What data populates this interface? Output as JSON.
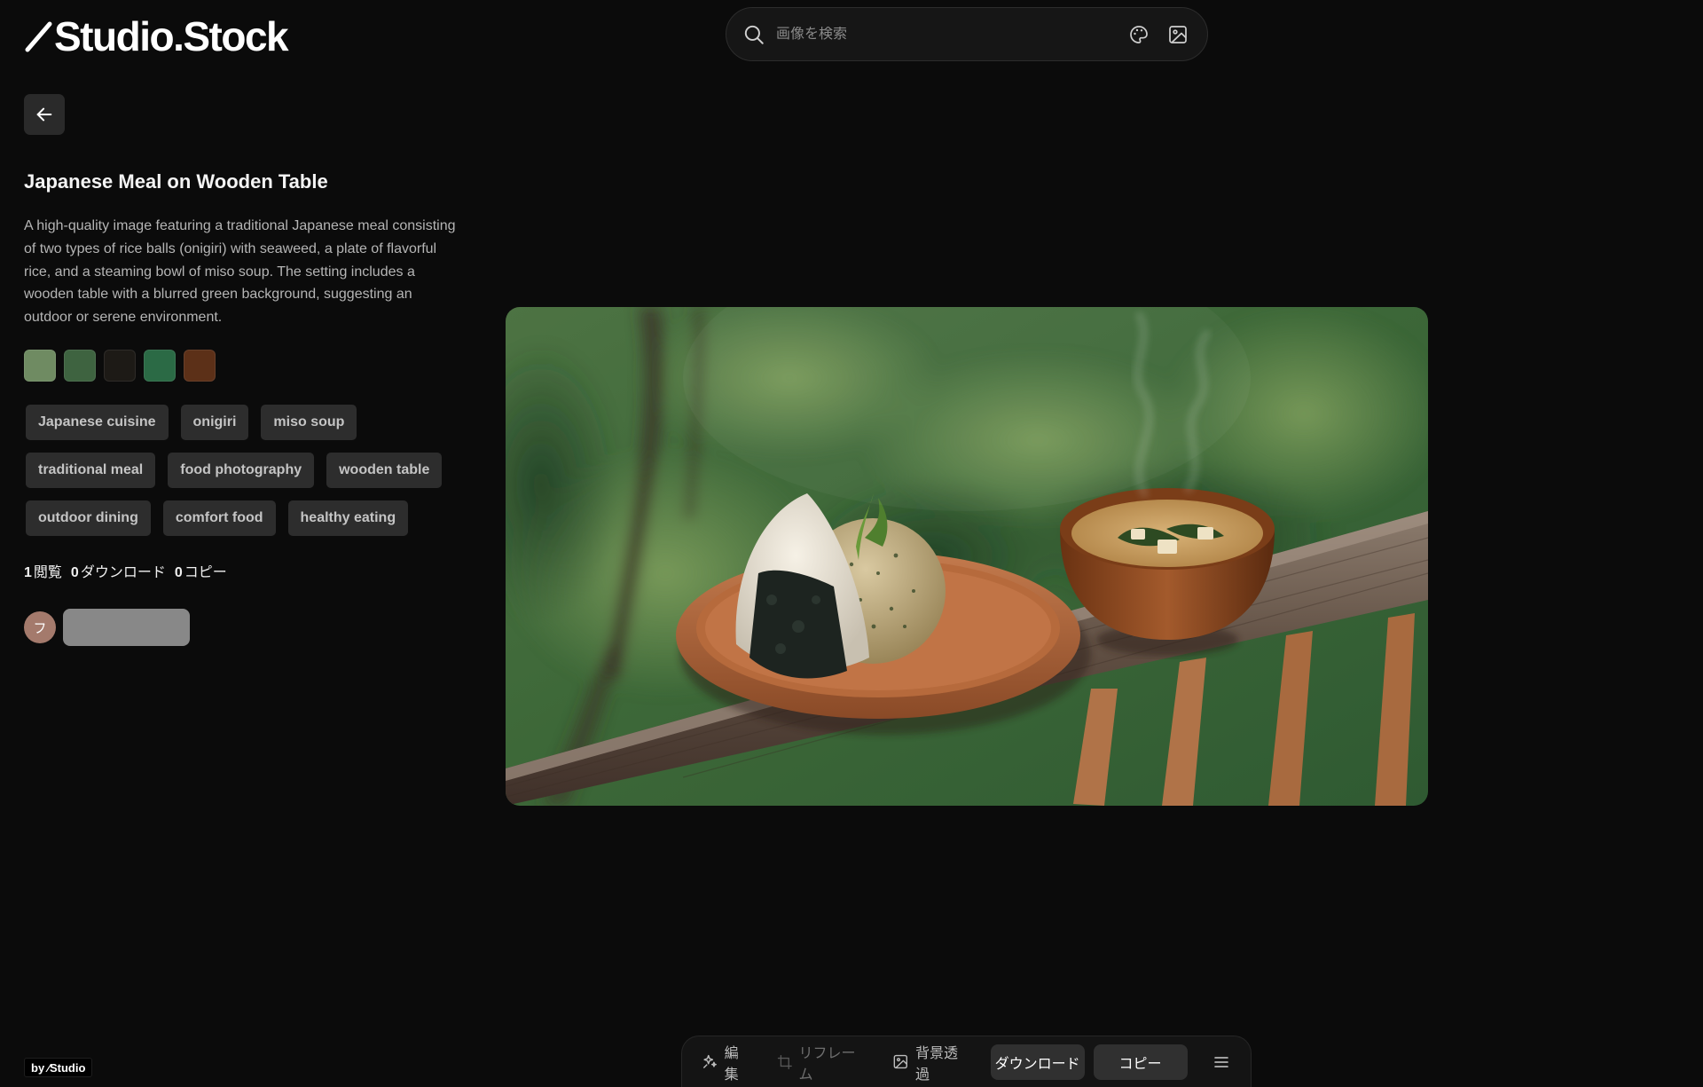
{
  "brand": {
    "logo_text": "Studio.Stock"
  },
  "search": {
    "placeholder": "画像を検索",
    "icons": [
      "search-icon",
      "palette-icon",
      "image-search-icon"
    ]
  },
  "back": {
    "icon": "arrow-left-icon"
  },
  "image": {
    "title": "Japanese Meal on Wooden Table",
    "description": "A high-quality image featuring a traditional Japanese meal consisting of two types of rice balls (onigiri) with seaweed, a plate of flavorful rice, and a steaming bowl of miso soup. The setting includes a wooden table with a blurred green background, suggesting an outdoor or serene environment."
  },
  "palette": [
    "#6f8b62",
    "#3e6340",
    "#1d1a16",
    "#2b6a45",
    "#5c3018"
  ],
  "tags": [
    "Japanese cuisine",
    "onigiri",
    "miso soup",
    "traditional meal",
    "food photography",
    "wooden table",
    "outdoor dining",
    "comfort food",
    "healthy eating"
  ],
  "stats": {
    "views": {
      "count": "1",
      "label": "閲覧"
    },
    "downloads": {
      "count": "0",
      "label": "ダウンロード"
    },
    "copies": {
      "count": "0",
      "label": "コピー"
    }
  },
  "author": {
    "initial": "フ",
    "avatar_color": "#a47a6c"
  },
  "footer": {
    "badge": "by ⁄Studio"
  },
  "toolbar": {
    "edit": "編集",
    "reframe": "リフレーム",
    "remove_bg": "背景透過",
    "download": "ダウンロード",
    "copy": "コピー",
    "icons": [
      "sparkle-icon",
      "crop-icon",
      "image-icon",
      "menu-icon"
    ]
  }
}
